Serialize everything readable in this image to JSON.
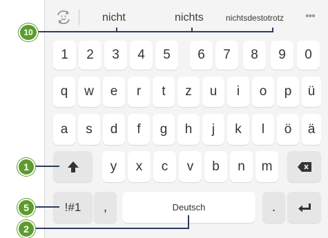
{
  "suggestions": {
    "s1": "nicht",
    "s2": "nichts",
    "s3": "nichtsdestotrotz",
    "more": "•••"
  },
  "callouts": {
    "c10": "10",
    "c1": "1",
    "c5": "5",
    "c2": "2"
  },
  "keys": {
    "row1": [
      "1",
      "2",
      "3",
      "4",
      "5",
      "6",
      "7",
      "8",
      "9",
      "0"
    ],
    "row2": [
      "q",
      "w",
      "e",
      "r",
      "t",
      "z",
      "u",
      "i",
      "o",
      "p",
      "ü"
    ],
    "row3": [
      "a",
      "s",
      "d",
      "f",
      "g",
      "h",
      "j",
      "k",
      "l",
      "ö",
      "ä"
    ],
    "row4": [
      "y",
      "x",
      "c",
      "v",
      "b",
      "n",
      "m"
    ],
    "symbols": "!#1",
    "comma": ",",
    "space": "Deutsch",
    "period": "."
  },
  "colors": {
    "callout_green": "#5d9b2e",
    "line_navy": "#2c3a5e"
  }
}
